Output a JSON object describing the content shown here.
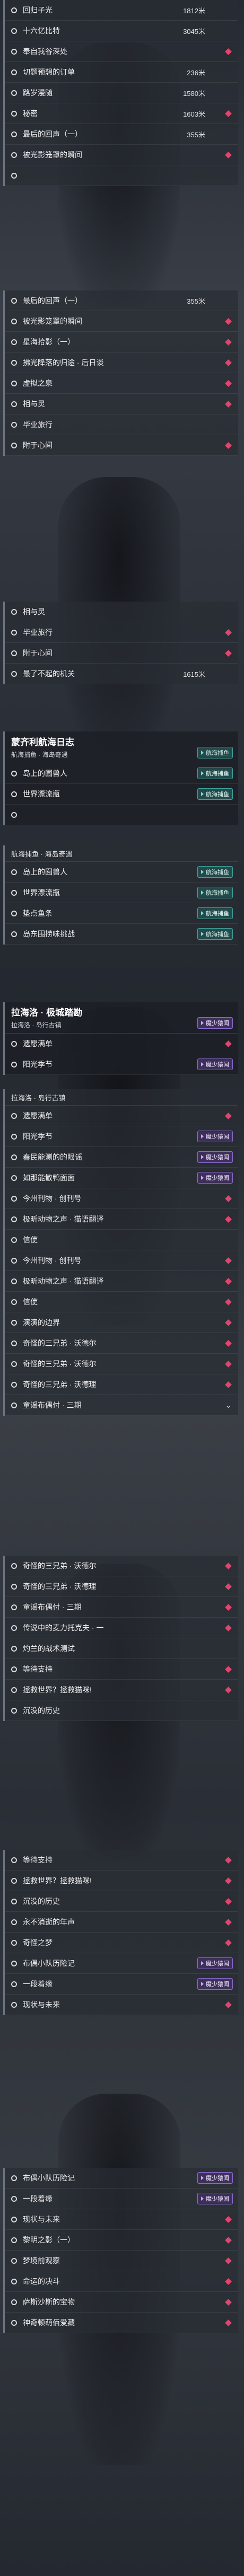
{
  "colors": {
    "diamond": "#e0466d",
    "purple_tag": "#3e2f5a",
    "teal_tag": "#24494a"
  },
  "tags": {
    "sea": "航海捕鱼",
    "mv": "魔少猿闻"
  },
  "panel1": {
    "rows": [
      {
        "label": "回归子光",
        "value": "1812米",
        "mark": "none"
      },
      {
        "label": "十六亿比特",
        "value": "3045米",
        "mark": "none"
      },
      {
        "label": "奉自我谷深处",
        "value": "",
        "mark": "diamond"
      },
      {
        "label": "切题预想的订单",
        "value": "236米",
        "mark": "none"
      },
      {
        "label": "路岁漫随",
        "value": "1580米",
        "mark": "none"
      },
      {
        "label": "秘密",
        "value": "1603米",
        "mark": "diamond"
      },
      {
        "label": "最后的回声（一）",
        "value": "355米",
        "mark": "none"
      },
      {
        "label": "被光影笼罩的瞬间",
        "value": "",
        "mark": "diamond"
      },
      {
        "label": "",
        "value": "",
        "mark": "none"
      }
    ]
  },
  "panel2": {
    "rows": [
      {
        "label": "最后的回声（一）",
        "value": "355米",
        "mark": "none"
      },
      {
        "label": "被光影笼罩的瞬间",
        "value": "",
        "mark": "diamond"
      },
      {
        "label": "星海拾影（一）",
        "value": "",
        "mark": "diamond"
      },
      {
        "label": "拂光降落的归途 · 后日谈",
        "value": "",
        "mark": "diamond"
      },
      {
        "label": "虚拟之泉",
        "value": "",
        "mark": "diamond"
      },
      {
        "label": "相与灵",
        "value": "",
        "mark": "diamond"
      },
      {
        "label": "毕业旅行",
        "value": "",
        "mark": "none"
      },
      {
        "label": "附于心间",
        "value": "",
        "mark": "diamond"
      }
    ]
  },
  "panel3": {
    "rows": [
      {
        "label": "相与灵",
        "value": "",
        "mark": "none"
      },
      {
        "label": "毕业旅行",
        "value": "",
        "mark": "diamond"
      },
      {
        "label": "附于心间",
        "value": "",
        "mark": "diamond"
      },
      {
        "label": "最了不起的机关",
        "value": "1615米",
        "mark": "none"
      }
    ]
  },
  "panel4": {
    "title": "蒙齐利航海日志",
    "sub": "航海捕鱼 · 海岛奇遇",
    "rows": [
      {
        "label": "岛上的囿兽人",
        "value": "",
        "mark": "sea"
      },
      {
        "label": "世界漂流瓶",
        "value": "",
        "mark": "sea"
      },
      {
        "label": "",
        "value": "",
        "mark": "none"
      }
    ]
  },
  "panel5": {
    "subhead": "航海捕鱼 · 海岛奇遇",
    "rows": [
      {
        "label": "岛上的囿兽人",
        "value": "",
        "mark": "sea"
      },
      {
        "label": "世界漂流瓶",
        "value": "",
        "mark": "sea"
      },
      {
        "label": "垫点鱼条",
        "value": "",
        "mark": "sea"
      },
      {
        "label": "岛东围捞味挑战",
        "value": "",
        "mark": "sea"
      }
    ]
  },
  "panel6": {
    "title": "拉海洛 · 极城踏勘",
    "sub": "拉海洛 · 岛行古镇",
    "rows": [
      {
        "label": "遗愿满单",
        "value": "",
        "mark": "diamond"
      },
      {
        "label": "阳光季节",
        "value": "",
        "mark": "mv"
      }
    ]
  },
  "panel7": {
    "subhead": "拉海洛 · 岛行古镇",
    "rows": [
      {
        "label": "遗愿满单",
        "value": "",
        "mark": "diamond"
      },
      {
        "label": "阳光季节",
        "value": "",
        "mark": "mv"
      },
      {
        "label": "春民能测的的眼谣",
        "value": "",
        "mark": "mv"
      },
      {
        "label": "如那能散鸭面面",
        "value": "",
        "mark": "mv"
      },
      {
        "label": "今州刊物 · 创刊号",
        "value": "",
        "mark": "diamond"
      },
      {
        "label": "极昕动物之声 · 猫语翻译",
        "value": "",
        "mark": "diamond"
      },
      {
        "label": "信使",
        "value": "",
        "mark": "none"
      },
      {
        "label": "今州刊物 · 创刊号",
        "value": "",
        "mark": "diamond"
      },
      {
        "label": "极昕动物之声 · 猫语翻译",
        "value": "",
        "mark": "diamond"
      },
      {
        "label": "信使",
        "value": "",
        "mark": "diamond"
      },
      {
        "label": "演演的边界",
        "value": "",
        "mark": "diamond"
      },
      {
        "label": "奇怪的三兄弟 · 沃德尔",
        "value": "",
        "mark": "diamond"
      },
      {
        "label": "奇怪的三兄弟 · 沃德尔",
        "value": "",
        "mark": "diamond"
      },
      {
        "label": "奇怪的三兄弟 · 沃德理",
        "value": "",
        "mark": "diamond"
      },
      {
        "label": "童谣布偶付 · 三期",
        "value": "",
        "mark": "chevron"
      }
    ]
  },
  "panel8": {
    "rows": [
      {
        "label": "奇怪的三兄弟 · 沃德尔",
        "value": "",
        "mark": "diamond"
      },
      {
        "label": "奇怪的三兄弟 · 沃德理",
        "value": "",
        "mark": "diamond"
      },
      {
        "label": "童谣布偶付 · 三期",
        "value": "",
        "mark": "diamond"
      },
      {
        "label": "传说中的麦力托克夫 · 一",
        "value": "",
        "mark": "diamond"
      },
      {
        "label": "灼兰的战术测试",
        "value": "",
        "mark": "none"
      },
      {
        "label": "等待支持",
        "value": "",
        "mark": "diamond"
      },
      {
        "label": "拯救世界？拯救猫咪!",
        "value": "",
        "mark": "diamond"
      },
      {
        "label": "沉没的历史",
        "value": "",
        "mark": "none"
      }
    ]
  },
  "panel9": {
    "rows": [
      {
        "label": "等待支持",
        "value": "",
        "mark": "diamond"
      },
      {
        "label": "拯救世界？拯救猫咪!",
        "value": "",
        "mark": "diamond"
      },
      {
        "label": "沉没的历史",
        "value": "",
        "mark": "diamond"
      },
      {
        "label": "永不消逝的年声",
        "value": "",
        "mark": "diamond"
      },
      {
        "label": "奇怪之梦",
        "value": "",
        "mark": "diamond"
      },
      {
        "label": "布偶小队历险记",
        "value": "",
        "mark": "mv"
      },
      {
        "label": "一段着缘",
        "value": "",
        "mark": "mv"
      },
      {
        "label": "现状与未来",
        "value": "",
        "mark": "diamond"
      }
    ]
  },
  "panel10": {
    "rows": [
      {
        "label": "布偶小队历险记",
        "value": "",
        "mark": "mv"
      },
      {
        "label": "一段着缘",
        "value": "",
        "mark": "mv"
      },
      {
        "label": "现状与未来",
        "value": "",
        "mark": "diamond"
      },
      {
        "label": "黎明之影（一）",
        "value": "",
        "mark": "diamond"
      },
      {
        "label": "梦境前观察",
        "value": "",
        "mark": "diamond"
      },
      {
        "label": "命运的决斗",
        "value": "",
        "mark": "diamond"
      },
      {
        "label": "萨斯沙斯的宝物",
        "value": "",
        "mark": "diamond"
      },
      {
        "label": "神奇顿萌佰爱藏",
        "value": "",
        "mark": "diamond"
      }
    ]
  }
}
